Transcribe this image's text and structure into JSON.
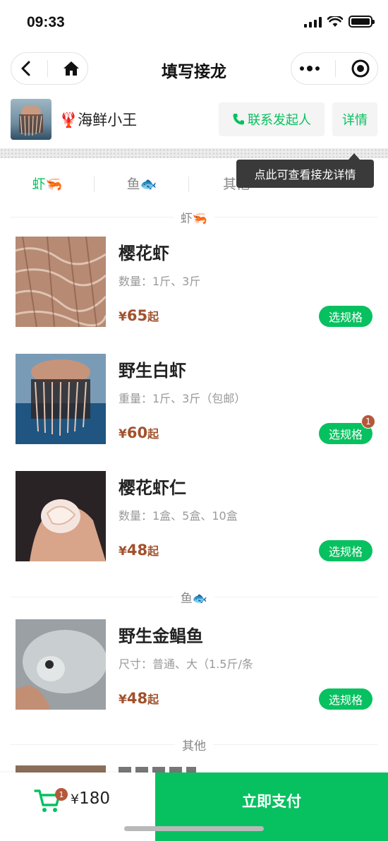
{
  "status_bar": {
    "time": "09:33"
  },
  "nav": {
    "title": "填写接龙"
  },
  "shop": {
    "emoji": "🦞",
    "name": "海鲜小王",
    "contact_label": "联系发起人",
    "details_label": "详情"
  },
  "tooltip": {
    "text": "点此可查看接龙详情"
  },
  "tabs": [
    {
      "label": "虾🦐",
      "active": true
    },
    {
      "label": "鱼🐟",
      "active": false
    },
    {
      "label": "其他",
      "active": false
    }
  ],
  "sections": [
    {
      "title": "虾🦐",
      "products": [
        {
          "name": "樱花虾",
          "spec": "数量：1斤、3斤",
          "price_symbol": "¥",
          "price": "65",
          "price_suffix": "起",
          "button": "选规格",
          "badge": ""
        },
        {
          "name": "野生白虾",
          "spec": "重量：1斤、3斤（包邮）",
          "price_symbol": "¥",
          "price": "60",
          "price_suffix": "起",
          "button": "选规格",
          "badge": "1"
        },
        {
          "name": "樱花虾仁",
          "spec": "数量：1盒、5盒、10盒",
          "price_symbol": "¥",
          "price": "48",
          "price_suffix": "起",
          "button": "选规格",
          "badge": ""
        }
      ]
    },
    {
      "title": "鱼🐟",
      "products": [
        {
          "name": "野生金鲳鱼",
          "spec": "尺寸：普通、大（1.5斤/条",
          "price_symbol": "¥",
          "price": "48",
          "price_suffix": "起",
          "button": "选规格",
          "badge": ""
        }
      ]
    },
    {
      "title": "其他",
      "products": []
    }
  ],
  "cart": {
    "count": "1",
    "total_symbol": "¥",
    "total": "180"
  },
  "pay": {
    "label": "立即支付"
  },
  "colors": {
    "accent": "#07c160",
    "price": "#a0522d",
    "badge": "#b5573a"
  }
}
